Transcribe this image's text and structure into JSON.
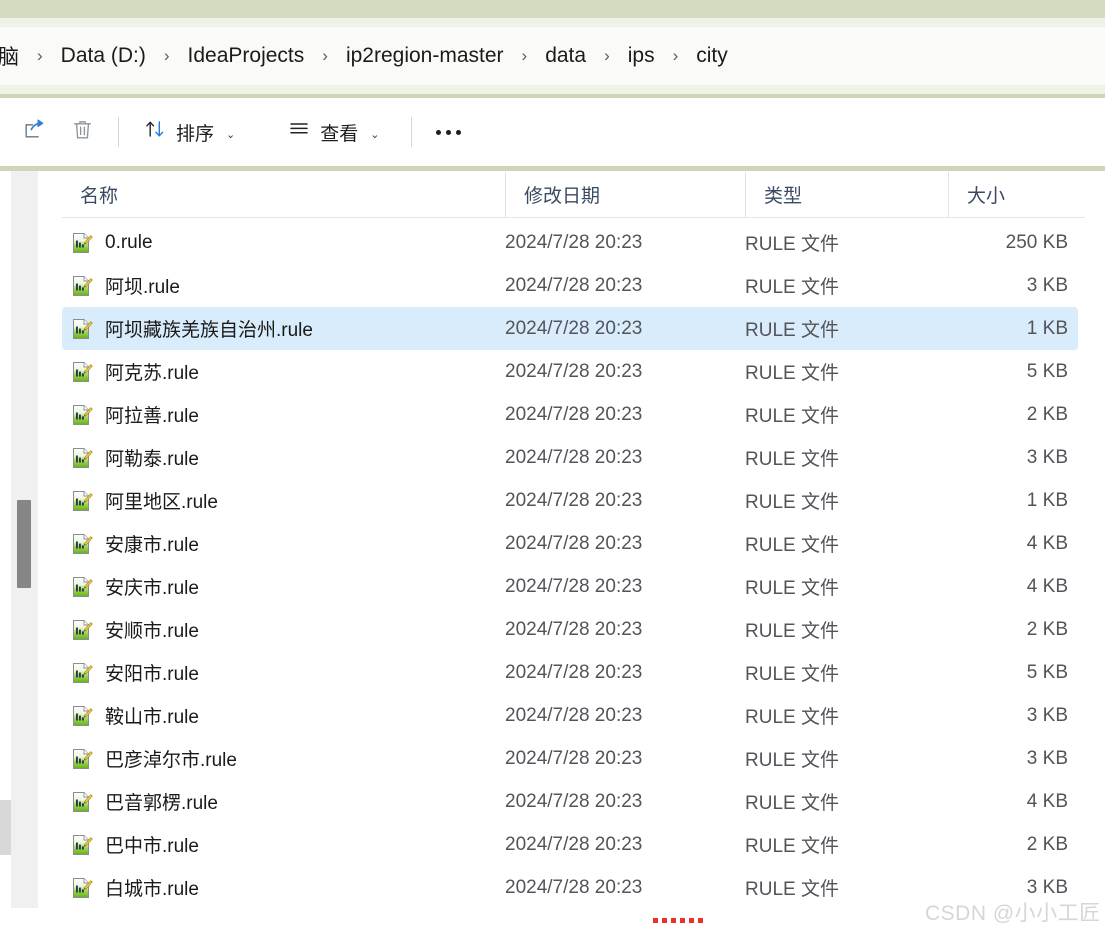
{
  "window": {
    "breadcrumb": {
      "items": [
        {
          "label": "脑",
          "truncated": true
        },
        {
          "label": "Data (D:)"
        },
        {
          "label": "IdeaProjects"
        },
        {
          "label": "ip2region-master"
        },
        {
          "label": "data"
        },
        {
          "label": "ips"
        },
        {
          "label": "city"
        }
      ],
      "separator": "›"
    }
  },
  "toolbar": {
    "share_icon": "share-icon",
    "delete_icon": "trash-icon",
    "sort_label": "排序",
    "sort_icon": "sort-arrows-icon",
    "view_label": "查看",
    "view_icon": "list-lines-icon",
    "more_label": "…",
    "chevron": "⌄"
  },
  "columns": {
    "name": "名称",
    "date_modified": "修改日期",
    "type": "类型",
    "size": "大小",
    "sort_by": "名称",
    "sort_direction": "ascending"
  },
  "files": [
    {
      "name": "0.rule",
      "date": "2024/7/28 20:23",
      "type": "RULE 文件",
      "size": "250 KB",
      "selected": false
    },
    {
      "name": "阿坝.rule",
      "date": "2024/7/28 20:23",
      "type": "RULE 文件",
      "size": "3 KB",
      "selected": false
    },
    {
      "name": "阿坝藏族羌族自治州.rule",
      "date": "2024/7/28 20:23",
      "type": "RULE 文件",
      "size": "1 KB",
      "selected": true
    },
    {
      "name": "阿克苏.rule",
      "date": "2024/7/28 20:23",
      "type": "RULE 文件",
      "size": "5 KB",
      "selected": false
    },
    {
      "name": "阿拉善.rule",
      "date": "2024/7/28 20:23",
      "type": "RULE 文件",
      "size": "2 KB",
      "selected": false
    },
    {
      "name": "阿勒泰.rule",
      "date": "2024/7/28 20:23",
      "type": "RULE 文件",
      "size": "3 KB",
      "selected": false
    },
    {
      "name": "阿里地区.rule",
      "date": "2024/7/28 20:23",
      "type": "RULE 文件",
      "size": "1 KB",
      "selected": false
    },
    {
      "name": "安康市.rule",
      "date": "2024/7/28 20:23",
      "type": "RULE 文件",
      "size": "4 KB",
      "selected": false
    },
    {
      "name": "安庆市.rule",
      "date": "2024/7/28 20:23",
      "type": "RULE 文件",
      "size": "4 KB",
      "selected": false
    },
    {
      "name": "安顺市.rule",
      "date": "2024/7/28 20:23",
      "type": "RULE 文件",
      "size": "2 KB",
      "selected": false
    },
    {
      "name": "安阳市.rule",
      "date": "2024/7/28 20:23",
      "type": "RULE 文件",
      "size": "5 KB",
      "selected": false
    },
    {
      "name": "鞍山市.rule",
      "date": "2024/7/28 20:23",
      "type": "RULE 文件",
      "size": "3 KB",
      "selected": false
    },
    {
      "name": "巴彦淖尔市.rule",
      "date": "2024/7/28 20:23",
      "type": "RULE 文件",
      "size": "3 KB",
      "selected": false
    },
    {
      "name": "巴音郭楞.rule",
      "date": "2024/7/28 20:23",
      "type": "RULE 文件",
      "size": "4 KB",
      "selected": false
    },
    {
      "name": "巴中市.rule",
      "date": "2024/7/28 20:23",
      "type": "RULE 文件",
      "size": "2 KB",
      "selected": false
    },
    {
      "name": "白城市.rule",
      "date": "2024/7/28 20:23",
      "type": "RULE 文件",
      "size": "3 KB",
      "selected": false
    }
  ],
  "overlay": {
    "watermark": "CSDN @小小工匠"
  },
  "colors": {
    "chrome_green": "#d3dcc0",
    "selection_blue": "#d9ecfb",
    "header_text": "#3a4a63",
    "accent_red": "#e8322a"
  }
}
